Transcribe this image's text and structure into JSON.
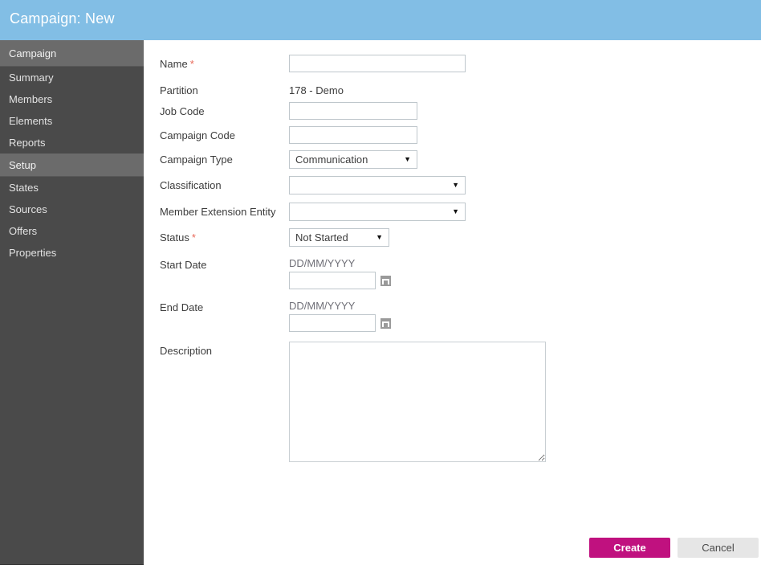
{
  "header": {
    "title": "Campaign: New",
    "background_color": "#82bee5"
  },
  "sidebar": {
    "background_color": "#4a4a4a",
    "section_color": "#6b6b6b",
    "groups": [
      {
        "section": "Campaign",
        "items": [
          "Summary",
          "Members",
          "Elements",
          "Reports"
        ]
      },
      {
        "section": "Setup",
        "items": [
          "States",
          "Sources",
          "Offers",
          "Properties"
        ]
      }
    ]
  },
  "form": {
    "name": {
      "label": "Name",
      "required": true,
      "value": "",
      "placeholder": ""
    },
    "partition": {
      "label": "Partition",
      "value": "178 - Demo"
    },
    "job_code": {
      "label": "Job Code",
      "value": "",
      "placeholder": ""
    },
    "campaign_code": {
      "label": "Campaign Code",
      "value": "",
      "placeholder": ""
    },
    "campaign_type": {
      "label": "Campaign Type",
      "selected": "Communication"
    },
    "classification": {
      "label": "Classification",
      "selected": ""
    },
    "member_extension_entity": {
      "label": "Member Extension Entity",
      "selected": ""
    },
    "status": {
      "label": "Status",
      "required": true,
      "selected": "Not Started"
    },
    "start_date": {
      "label": "Start Date",
      "format_hint": "DD/MM/YYYY",
      "value": "",
      "placeholder": ""
    },
    "end_date": {
      "label": "End Date",
      "format_hint": "DD/MM/YYYY",
      "value": "",
      "placeholder": ""
    },
    "description": {
      "label": "Description",
      "value": "",
      "placeholder": ""
    },
    "required_marker": "*",
    "dropdown_caret": "▼"
  },
  "footer": {
    "create_label": "Create",
    "cancel_label": "Cancel",
    "create_color": "#c0117f",
    "cancel_color": "#e6e6e6"
  }
}
